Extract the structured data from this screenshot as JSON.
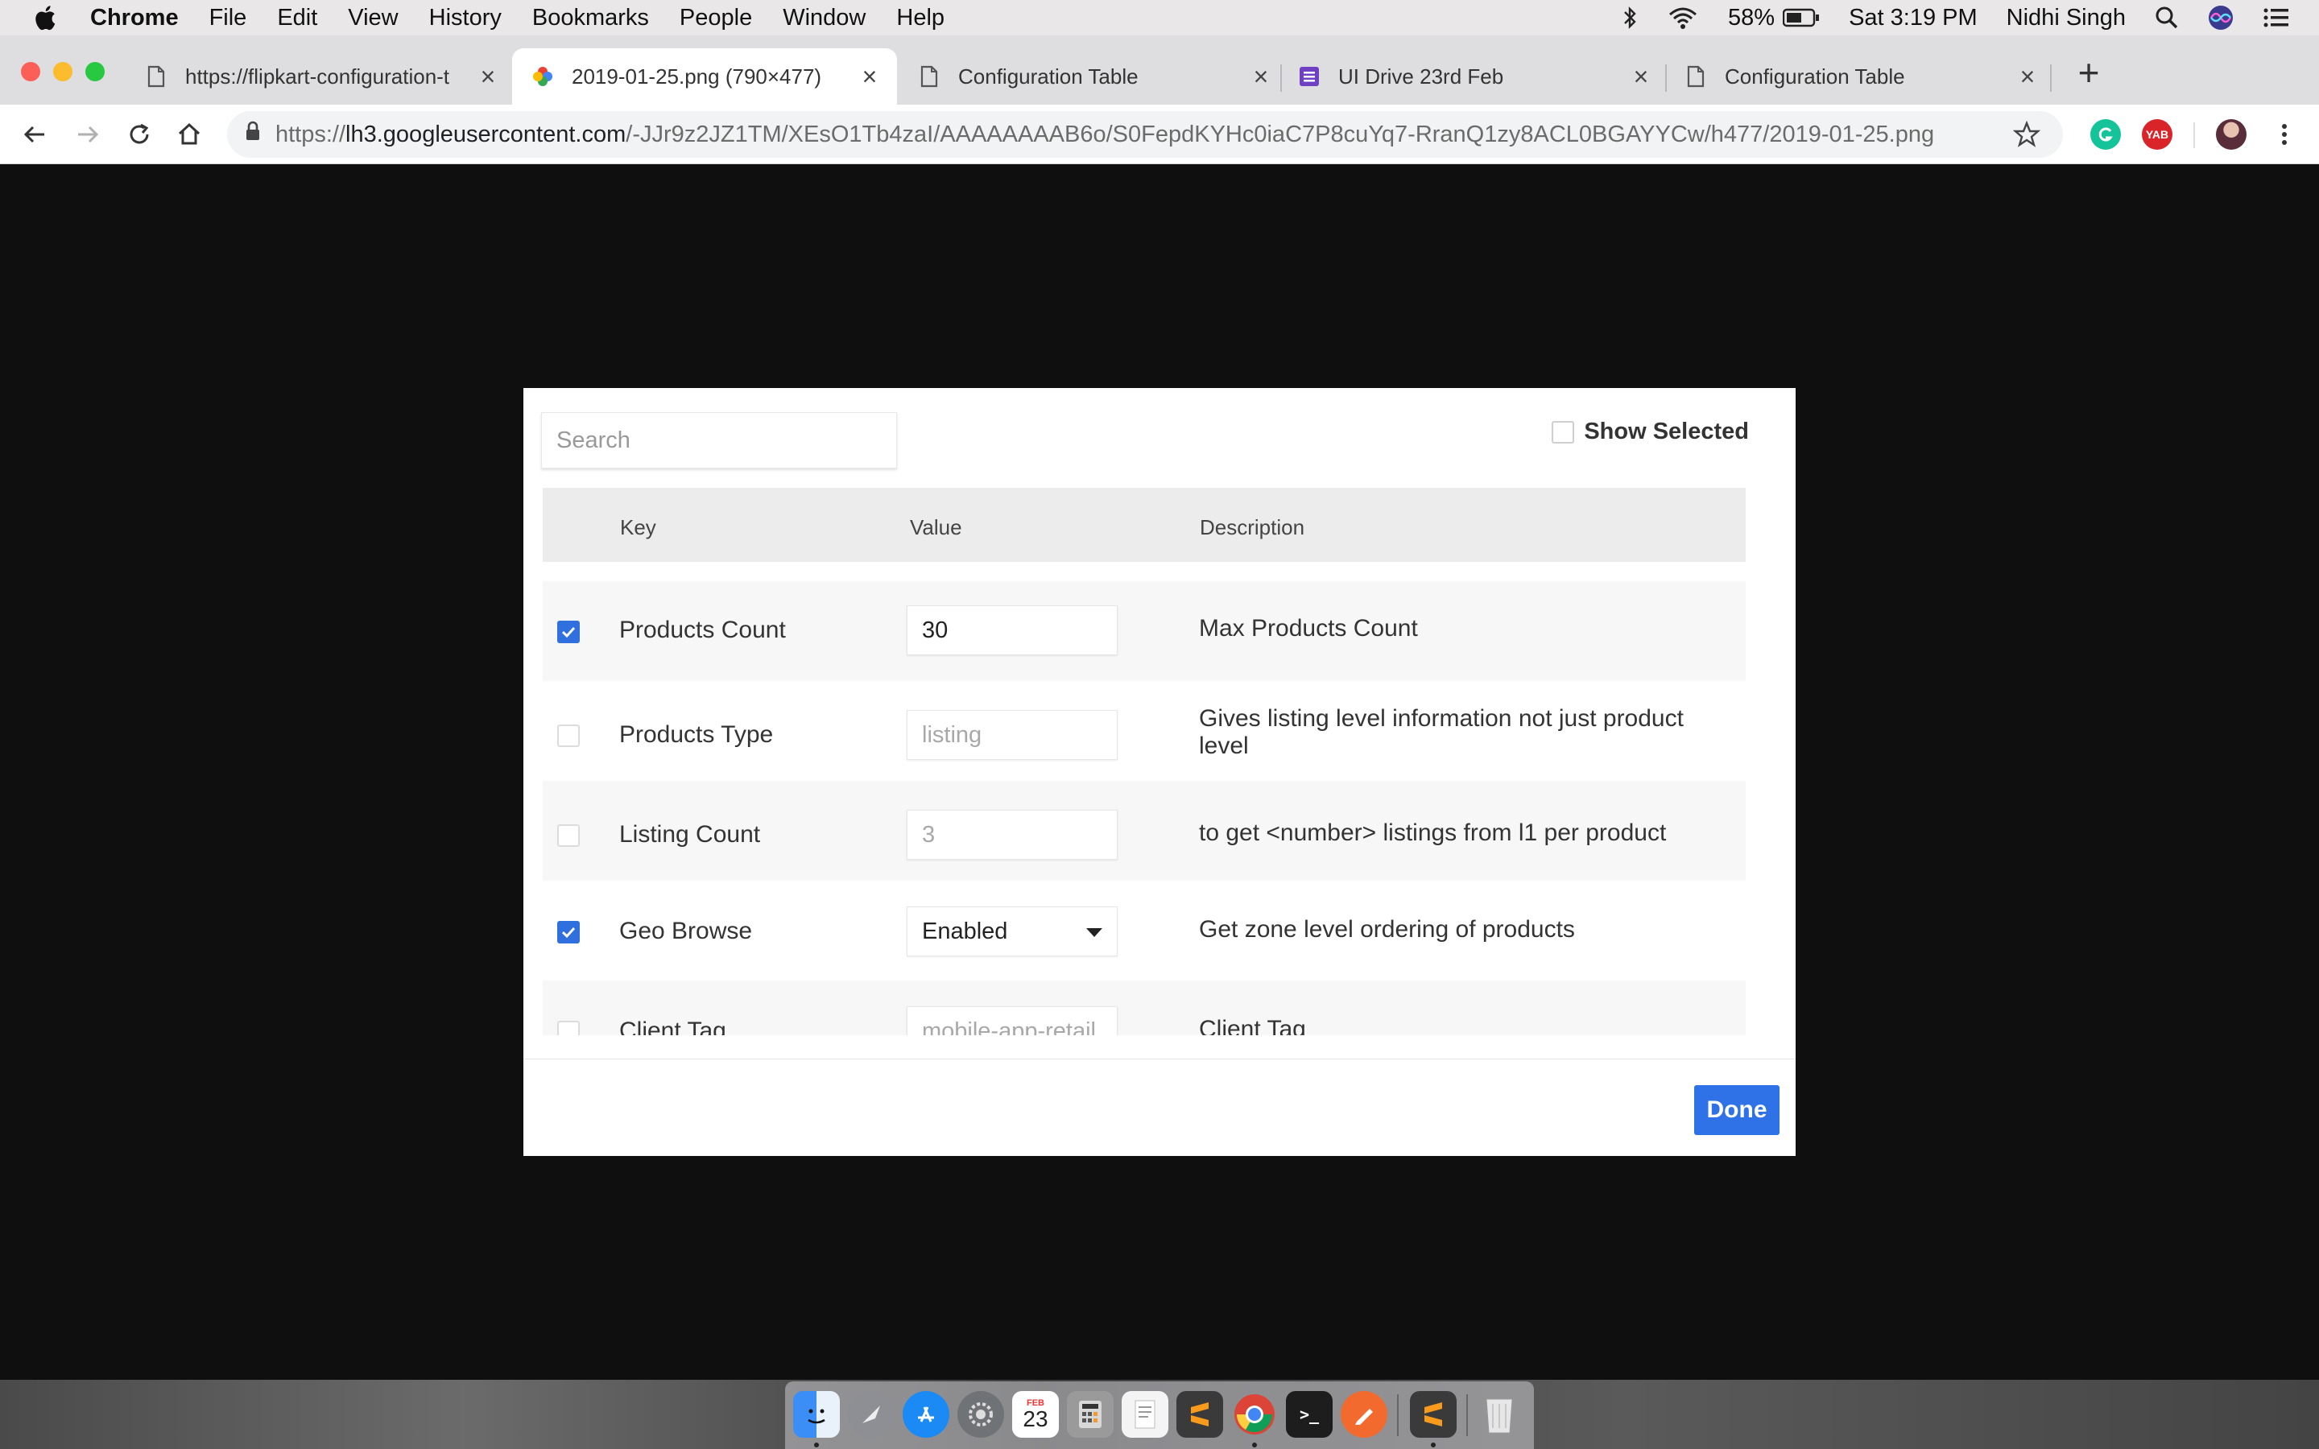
{
  "menubar": {
    "items": [
      "Chrome",
      "File",
      "Edit",
      "View",
      "History",
      "Bookmarks",
      "People",
      "Window",
      "Help"
    ],
    "battery": "58%",
    "clock": "Sat 3:19 PM",
    "user": "Nidhi Singh"
  },
  "tabs": [
    {
      "title": "https://flipkart-configuration-t",
      "icon": "document-icon"
    },
    {
      "title": "2019-01-25.png (790×477)",
      "icon": "photos-icon"
    },
    {
      "title": "Configuration Table",
      "icon": "document-icon"
    },
    {
      "title": "UI Drive 23rd Feb",
      "icon": "sheets-icon"
    },
    {
      "title": "Configuration Table",
      "icon": "document-icon"
    }
  ],
  "newtab_label": "+",
  "address": {
    "scheme": "https://",
    "host": "lh3.googleusercontent.com",
    "path": "/-JJr9z2JZ1TM/XEsO1Tb4zaI/AAAAAAAAB6o/S0FepdKYHc0iaC7P8cuYq7-RranQ1zy8ACL0BGAYYCw/h477/2019-01-25.png"
  },
  "extensions": {
    "yab_label": "YAB"
  },
  "modal": {
    "search_placeholder": "Search",
    "show_selected_label": "Show Selected",
    "columns": {
      "key": "Key",
      "value": "Value",
      "description": "Description"
    },
    "rows": [
      {
        "key": "Products Count",
        "value": "30",
        "description": "Max Products Count",
        "checked": true
      },
      {
        "key": "Products Type",
        "value": "listing",
        "description": "Gives listing level information not just product level",
        "checked": false
      },
      {
        "key": "Listing Count",
        "value": "3",
        "description": "to get <number> listings from l1 per product",
        "checked": false
      },
      {
        "key": "Geo Browse",
        "value": "Enabled",
        "description": "Get zone level ordering of products",
        "checked": true
      },
      {
        "key": "Client Tag",
        "value": "mobile-app-retail",
        "description": "Client Tag",
        "checked": false
      }
    ],
    "done_label": "Done"
  },
  "dock": {
    "calendar_day": "23",
    "calendar_month": "FEB",
    "terminal_glyph": ">_"
  },
  "colors": {
    "accent_blue": "#2f71e6",
    "checkbox_blue": "#2f6fde",
    "page_bg": "#0f0f0f"
  }
}
